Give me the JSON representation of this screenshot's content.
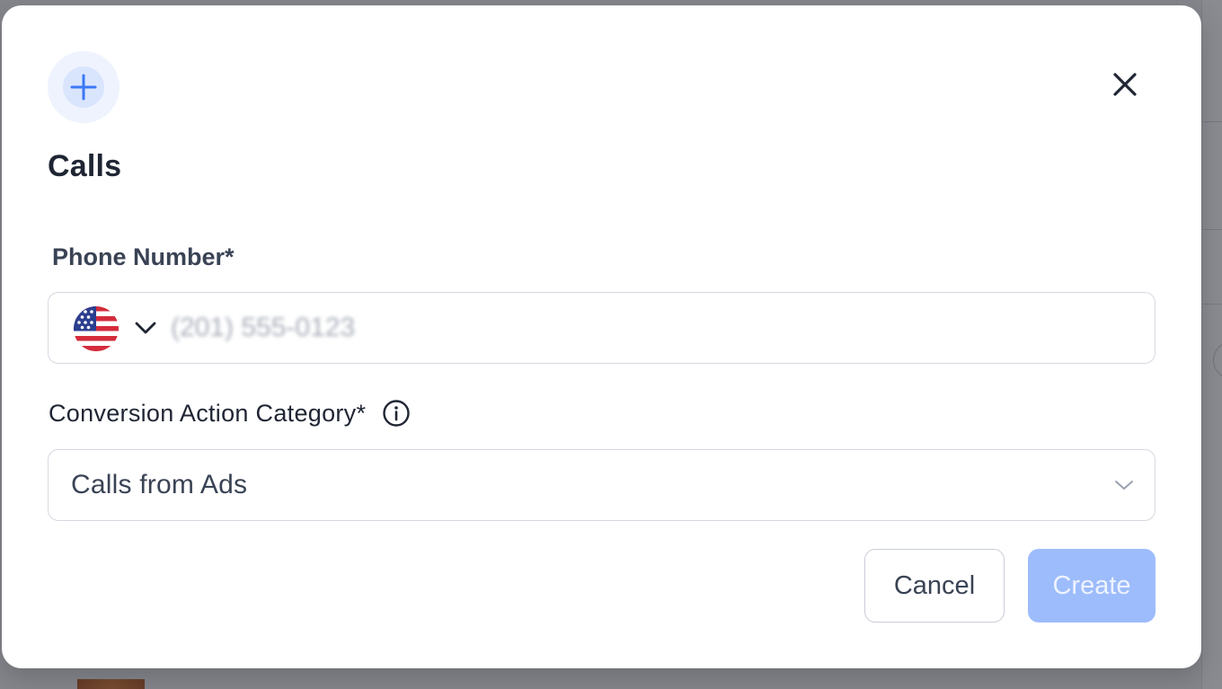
{
  "dialog": {
    "title": "Calls",
    "close_label": "Close"
  },
  "phone_field": {
    "label": "Phone Number*",
    "placeholder": "(201) 555-0123",
    "value": "",
    "country_flag": "us-flag-icon"
  },
  "category_field": {
    "label": "Conversion Action Category*",
    "info_icon": "info-icon",
    "selected_value": "Calls from Ads"
  },
  "actions": {
    "cancel_label": "Cancel",
    "create_label": "Create",
    "create_disabled": true
  },
  "colors": {
    "accent": "#3b78f5",
    "create_disabled_bg": "#9dbcfb",
    "text_primary": "#1f2533",
    "text_secondary": "#3a4355",
    "border": "#d5d9e0"
  }
}
